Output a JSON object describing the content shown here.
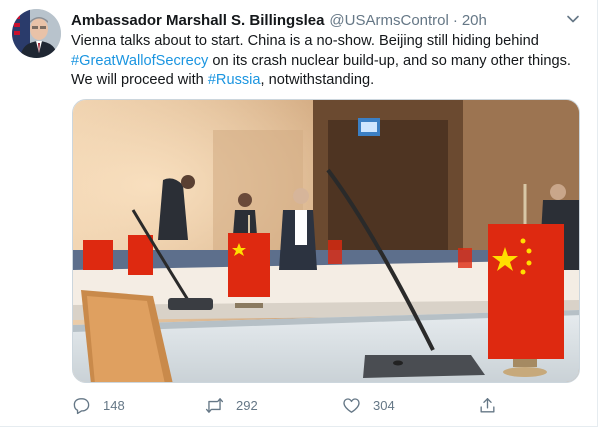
{
  "author": {
    "display_name": "Ambassador Marshall S. Billingslea",
    "handle": "@USArmsControl",
    "separator": "·",
    "time": "20h"
  },
  "tweet": {
    "line1": "Vienna talks about to start. China is a no-show. Beijing still hiding behind",
    "hashtag1": "#GreatWallofSecrecy",
    "line2_rest": " on its crash nuclear build-up, and so many other things.",
    "line3_start": "We will proceed with ",
    "hashtag2": "#Russia",
    "line3_end": ", notwithstanding."
  },
  "actions": {
    "reply_count": "148",
    "retweet_count": "292",
    "like_count": "304"
  },
  "colors": {
    "link": "#1b95e0",
    "secondary_text": "#657786",
    "primary_text": "#14171a",
    "flag_red": "#de2910",
    "flag_yellow": "#ffde00"
  },
  "icons": [
    "avatar-photo",
    "chevron-down-icon",
    "reply-icon",
    "retweet-icon",
    "heart-icon",
    "share-icon"
  ]
}
